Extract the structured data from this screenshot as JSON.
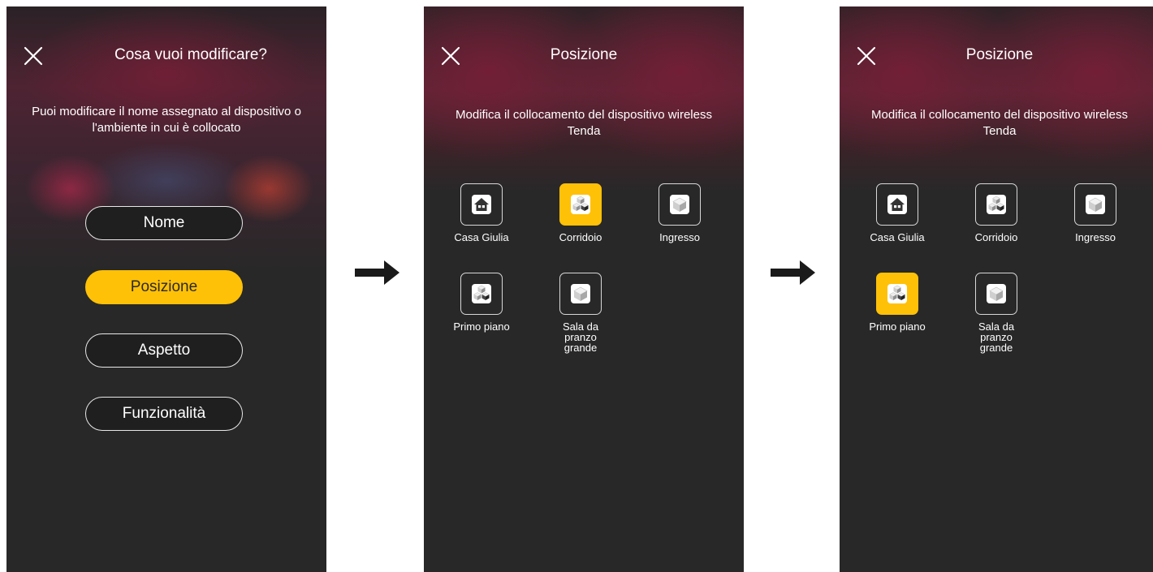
{
  "screen1": {
    "title": "Cosa vuoi modificare?",
    "description": "Puoi modificare il nome assegnato al dispositivo o l'ambiente in cui è collocato",
    "options": [
      {
        "label": "Nome",
        "selected": false
      },
      {
        "label": "Posizione",
        "selected": true
      },
      {
        "label": "Aspetto",
        "selected": false
      },
      {
        "label": "Funzionalità",
        "selected": false
      }
    ]
  },
  "screen2": {
    "title": "Posizione",
    "description": "Modifica il collocamento del dispositivo wireless Tenda",
    "rooms": [
      {
        "label": "Casa Giulia",
        "icon": "house-icon",
        "selected": false
      },
      {
        "label": "Corridoio",
        "icon": "cubes-icon",
        "selected": true
      },
      {
        "label": "Ingresso",
        "icon": "cube-icon",
        "selected": false
      },
      {
        "label": "Primo piano",
        "icon": "cubes-icon",
        "selected": false
      },
      {
        "label": "Sala da pranzo grande",
        "icon": "cube-icon",
        "selected": false
      }
    ]
  },
  "screen3": {
    "title": "Posizione",
    "description": "Modifica il collocamento del dispositivo wireless Tenda",
    "rooms": [
      {
        "label": "Casa Giulia",
        "icon": "house-icon",
        "selected": false
      },
      {
        "label": "Corridoio",
        "icon": "cubes-icon",
        "selected": false
      },
      {
        "label": "Ingresso",
        "icon": "cube-icon",
        "selected": false
      },
      {
        "label": "Primo piano",
        "icon": "cubes-icon",
        "selected": true
      },
      {
        "label": "Sala da pranzo grande",
        "icon": "cube-icon",
        "selected": false
      }
    ]
  },
  "colors": {
    "accent": "#ffc107",
    "background": "#282828",
    "text": "#ffffff"
  }
}
